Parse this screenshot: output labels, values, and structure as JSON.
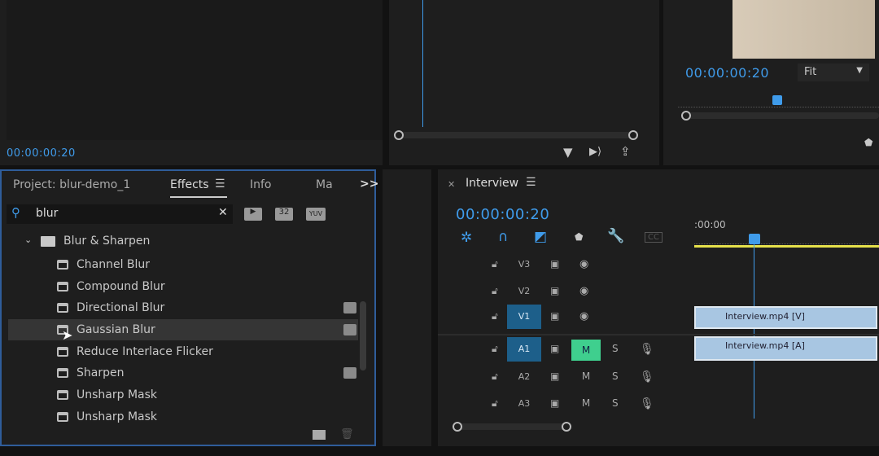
{
  "source_monitor": {
    "timecode": "00:00:00:20"
  },
  "program_monitor": {
    "timecode": "00:00:00:20",
    "fit": "Fit",
    "fit_chevron": "chevron-down-icon"
  },
  "project_panel": {
    "tabs": [
      {
        "label": "Project: blur-demo_1"
      },
      {
        "label": "Effects",
        "active": true
      },
      {
        "label": "Info"
      },
      {
        "label": "Ma"
      }
    ],
    "overflow": ">>",
    "search": {
      "value": "blur"
    },
    "filter_badges": [
      "accelerated",
      "32",
      "YUV"
    ],
    "folder": "Blur & Sharpen",
    "effects": [
      {
        "label": "Channel Blur",
        "badge": false
      },
      {
        "label": "Compound Blur",
        "badge": false
      },
      {
        "label": "Directional Blur",
        "badge": true
      },
      {
        "label": "Gaussian Blur",
        "badge": true,
        "selected": true
      },
      {
        "label": "Reduce Interlace Flicker",
        "badge": false
      },
      {
        "label": "Sharpen",
        "badge": true
      },
      {
        "label": "Unsharp Mask",
        "badge": false
      },
      {
        "label": "Unsharp Mask",
        "badge": false
      }
    ]
  },
  "timeline": {
    "title": "Interview",
    "timecode": "00:00:00:20",
    "ruler_start": ":00:00",
    "video_tracks": [
      {
        "name": "V3"
      },
      {
        "name": "V2"
      },
      {
        "name": "V1",
        "targeted": true
      }
    ],
    "audio_tracks": [
      {
        "name": "A1",
        "targeted": true,
        "mute": true
      },
      {
        "name": "A2"
      },
      {
        "name": "A3"
      }
    ],
    "m_label": "M",
    "s_label": "S",
    "cc_label": "CC",
    "clips": {
      "video": "Interview.mp4 [V]",
      "audio": "Interview.mp4 [A]"
    },
    "colors": {
      "accent": "#3f9bea",
      "workarea": "#e5e04a",
      "mute": "#3fcf8e"
    }
  }
}
